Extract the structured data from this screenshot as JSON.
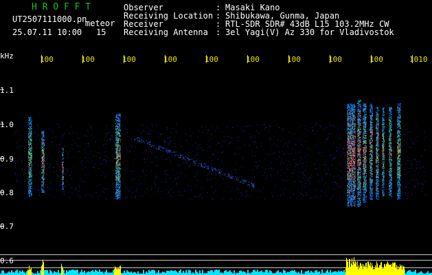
{
  "header": {
    "app_name": "H R O F F T",
    "filename": "UT2507111000.pn",
    "mode": "meteor",
    "datetime": "25.07.11 10:00",
    "count": "15"
  },
  "info": {
    "labels": [
      "Observer",
      "Receiving Location",
      "Receiver",
      "Receiving Antenna"
    ],
    "separator": ":",
    "values": [
      "Masaki Kano",
      "Shibukawa, Gunma, Japan",
      "RTL-SDR SDR# 43dB L15 103.2MHz CW",
      "3el Yagi(V) Az 330 for Vladivostok"
    ]
  },
  "axes": {
    "y_unit": "kHz",
    "y_ticks": [
      "1.1",
      "1.0",
      "0.9",
      "0.8",
      "0.7",
      "0.6"
    ],
    "x_ticks": [
      "100",
      "100",
      "100",
      "100",
      "100",
      "100",
      "100",
      "100",
      "100",
      "1010"
    ]
  },
  "colors": {
    "background": "#000000",
    "title_green": "#19c219",
    "text_white": "#ffffff",
    "tick_yellow": "#e6e600",
    "tick_gray": "#c8c8c8",
    "baseline_cyan": "#00e6ff",
    "peak_yellow": "#ffff00"
  }
}
